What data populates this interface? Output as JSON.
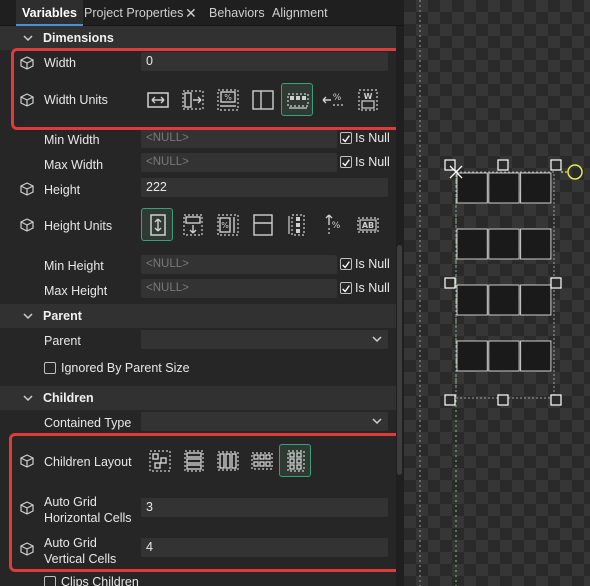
{
  "tabs": {
    "variables": "Variables",
    "project_properties": "Project Properties",
    "close": "✕",
    "behaviors": "Behaviors",
    "alignment": "Alignment"
  },
  "sections": {
    "dimensions": "Dimensions",
    "parent": "Parent",
    "children": "Children"
  },
  "dimensions": {
    "width_label": "Width",
    "width_value": "0",
    "width_units_label": "Width Units",
    "min_width_label": "Min Width",
    "min_width_value": "<NULL>",
    "max_width_label": "Max Width",
    "max_width_value": "<NULL>",
    "height_label": "Height",
    "height_value": "222",
    "height_units_label": "Height Units",
    "min_height_label": "Min Height",
    "min_height_value": "<NULL>",
    "max_height_label": "Max Height",
    "max_height_value": "<NULL>",
    "is_null_label": "Is Null",
    "is_null_checked": true
  },
  "parent": {
    "parent_label": "Parent",
    "parent_value": "",
    "ignored_label": "Ignored By Parent Size",
    "ignored_checked": false
  },
  "children": {
    "contained_type_label": "Contained Type",
    "contained_type_value": "",
    "layout_label": "Children Layout",
    "auto_h_label_1": "Auto Grid",
    "auto_h_label_2": "Horizontal Cells",
    "auto_h_value": "3",
    "auto_v_label_1": "Auto Grid",
    "auto_v_label_2": "Vertical Cells",
    "auto_v_value": "4",
    "clips_label": "Clips Children",
    "clips_checked": false
  },
  "icons": {
    "section_chevron": "chevron-down-icon",
    "property_icon": "cube-icon",
    "width_units": [
      "width-absolute-icon",
      "width-relative-container-icon",
      "width-percent-container-icon",
      "width-fill-icon",
      "width-relative-children-icon",
      "width-percent-other-icon",
      "width-ratio-icon"
    ],
    "width_units_selected": 4,
    "height_units": [
      "height-absolute-icon",
      "height-relative-container-icon",
      "height-percent-container-icon",
      "height-fill-icon",
      "height-relative-children-icon",
      "height-percent-other-icon",
      "height-ratio-icon"
    ],
    "height_units_selected": 0,
    "children_layout": [
      "regular-layout-icon",
      "top-to-bottom-stack-icon",
      "left-to-right-stack-icon",
      "auto-grid-horizontal-icon",
      "auto-grid-vertical-icon"
    ],
    "children_layout_selected": 4
  },
  "colors": {
    "panel_bg": "#262626",
    "highlight": "#e03b3b",
    "selected_button": "#3aa07a",
    "tab_accent": "#4a90d9",
    "selection_handle": "#ffffff",
    "origin_marker": "#e8e85a"
  },
  "canvas": {
    "grid_columns": 3,
    "grid_rows": 4
  }
}
